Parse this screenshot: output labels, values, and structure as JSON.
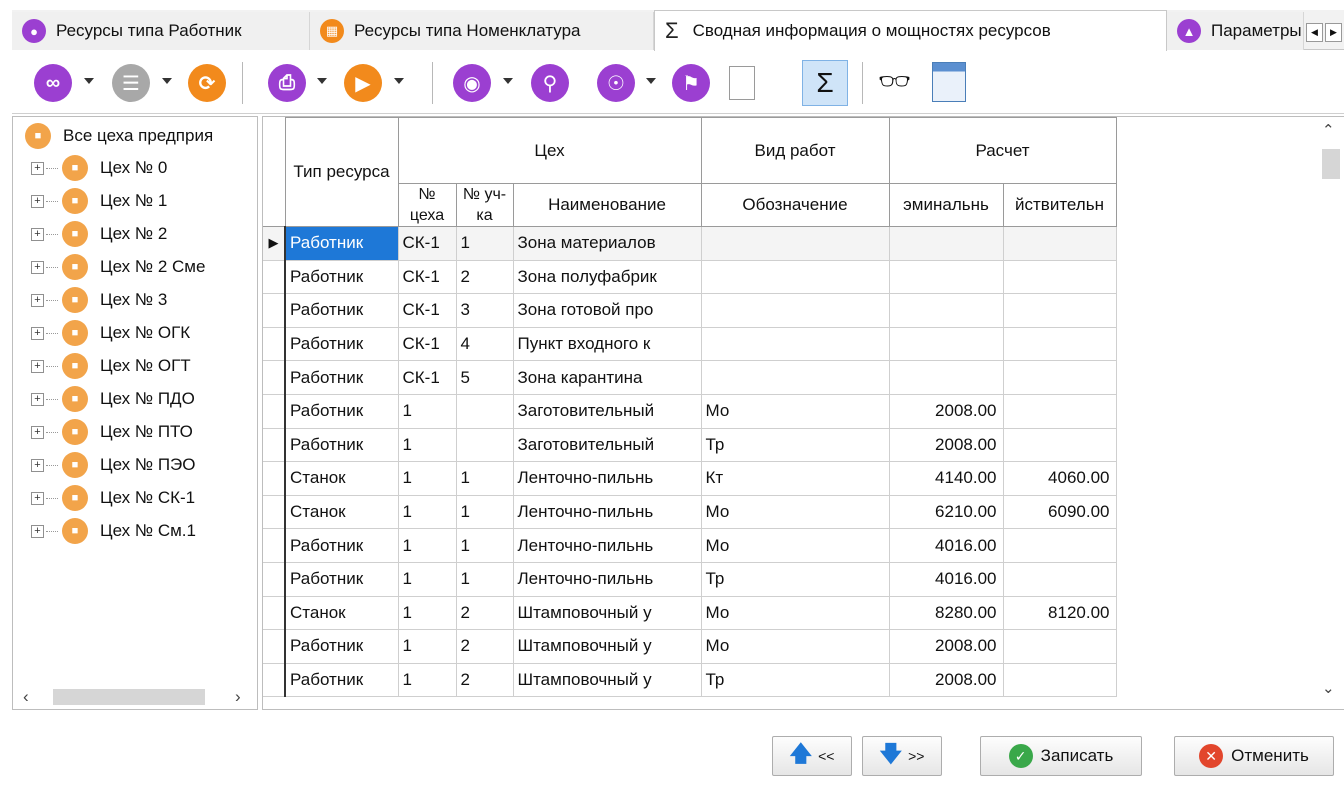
{
  "tabs": [
    {
      "label": "Ресурсы типа Работник",
      "icon": "worker-icon",
      "active": false
    },
    {
      "label": "Ресурсы типа Номенклатура",
      "icon": "nomenclature-icon",
      "active": false
    },
    {
      "label": "Сводная информация о мощностях ресурсов",
      "icon": "sigma-icon",
      "active": true
    },
    {
      "label": "Параметры",
      "icon": "compass-icon",
      "active": false
    }
  ],
  "tab_sigma": "Σ",
  "tree": {
    "root": "Все цеха предприя",
    "items": [
      "Цех № 0",
      "Цех № 1",
      "Цех № 2",
      "Цех № 2 Сме",
      "Цех № 3",
      "Цех № ОГК",
      "Цех № ОГТ",
      "Цех № ПДО",
      "Цех № ПТО",
      "Цех № ПЭО",
      "Цех № СК-1",
      "Цех № См.1"
    ]
  },
  "grid": {
    "headers": {
      "type": "Тип ресурса",
      "workshop_group": "Цех",
      "workshop_no": "№ цеха",
      "section_no": "№ уч-ка",
      "name": "Наименование",
      "work_kind_group": "Вид работ",
      "designation": "Обозначение",
      "calc_group": "Расчет",
      "nominal": "эминальнь",
      "actual": "йствительн"
    },
    "rows": [
      {
        "type": "Работник",
        "shop": "СК-1",
        "section": "1",
        "name": "Зона материалов",
        "work": "",
        "nominal": "",
        "actual": ""
      },
      {
        "type": "Работник",
        "shop": "СК-1",
        "section": "2",
        "name": "Зона полуфабрик",
        "work": "",
        "nominal": "",
        "actual": ""
      },
      {
        "type": "Работник",
        "shop": "СК-1",
        "section": "3",
        "name": "Зона готовой про",
        "work": "",
        "nominal": "",
        "actual": ""
      },
      {
        "type": "Работник",
        "shop": "СК-1",
        "section": "4",
        "name": "Пункт входного к",
        "work": "",
        "nominal": "",
        "actual": ""
      },
      {
        "type": "Работник",
        "shop": "СК-1",
        "section": "5",
        "name": "Зона карантина",
        "work": "",
        "nominal": "",
        "actual": ""
      },
      {
        "type": "Работник",
        "shop": "1",
        "section": "",
        "name": "Заготовительный",
        "work": "Мо",
        "nominal": "2008.00",
        "actual": ""
      },
      {
        "type": "Работник",
        "shop": "1",
        "section": "",
        "name": "Заготовительный",
        "work": "Тр",
        "nominal": "2008.00",
        "actual": ""
      },
      {
        "type": "Станок",
        "shop": "1",
        "section": "1",
        "name": "Ленточно-пильнь",
        "work": "Кт",
        "nominal": "4140.00",
        "actual": "4060.00"
      },
      {
        "type": "Станок",
        "shop": "1",
        "section": "1",
        "name": "Ленточно-пильнь",
        "work": "Мо",
        "nominal": "6210.00",
        "actual": "6090.00"
      },
      {
        "type": "Работник",
        "shop": "1",
        "section": "1",
        "name": "Ленточно-пильнь",
        "work": "Мо",
        "nominal": "4016.00",
        "actual": ""
      },
      {
        "type": "Работник",
        "shop": "1",
        "section": "1",
        "name": "Ленточно-пильнь",
        "work": "Тр",
        "nominal": "4016.00",
        "actual": ""
      },
      {
        "type": "Станок",
        "shop": "1",
        "section": "2",
        "name": "Штамповочный у",
        "work": "Мо",
        "nominal": "8280.00",
        "actual": "8120.00"
      },
      {
        "type": "Работник",
        "shop": "1",
        "section": "2",
        "name": "Штамповочный у",
        "work": "Мо",
        "nominal": "2008.00",
        "actual": ""
      },
      {
        "type": "Работник",
        "shop": "1",
        "section": "2",
        "name": "Штамповочный у",
        "work": "Тр",
        "nominal": "2008.00",
        "actual": ""
      }
    ]
  },
  "buttons": {
    "prev": "<<",
    "next": ">>",
    "save": "Записать",
    "cancel": "Отменить"
  },
  "colors": {
    "accent": "#1e78d7",
    "toolbar_purple": "#9b3fd1",
    "toolbar_orange": "#f28a1c",
    "workshop_icon": "#f2a44a",
    "save_green": "#3aa84a",
    "cancel_red": "#e2462c"
  }
}
